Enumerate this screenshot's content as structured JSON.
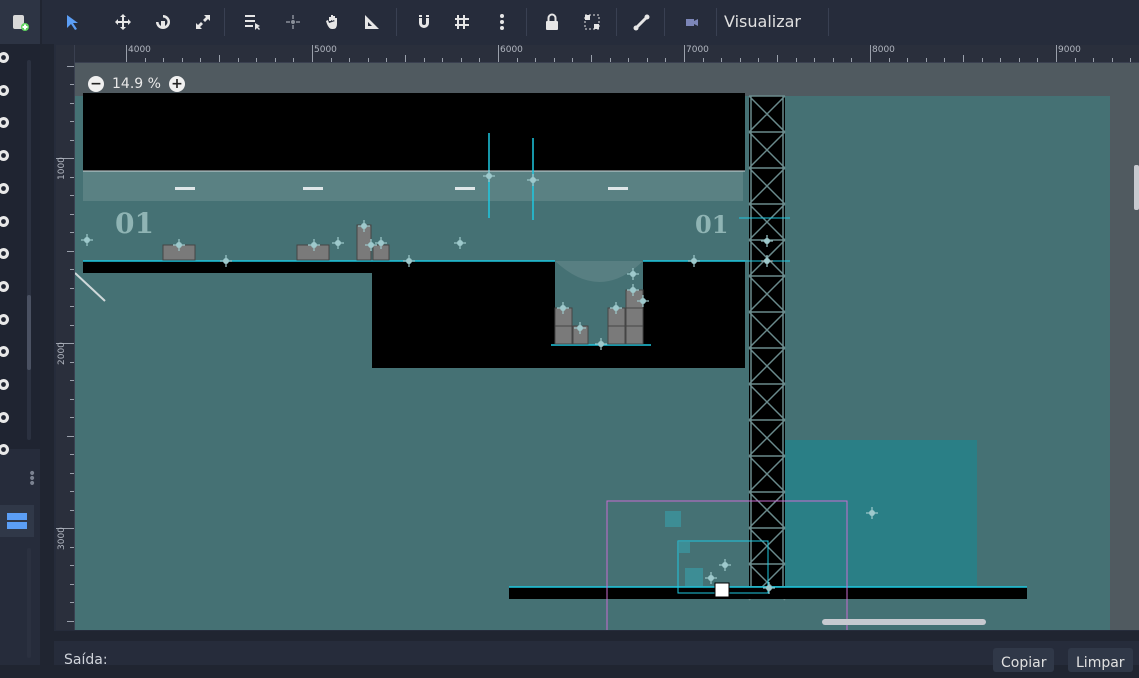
{
  "toolbar": {
    "tools": [
      {
        "name": "select-tool",
        "icon": "arrow-select-icon"
      },
      {
        "name": "move-tool",
        "icon": "move-icon"
      },
      {
        "name": "rotate-tool",
        "icon": "rotate-icon"
      },
      {
        "name": "scale-tool",
        "icon": "scale-icon"
      },
      {
        "name": "list-select-tool",
        "icon": "list-select-icon"
      },
      {
        "name": "pivot-tool",
        "icon": "pivot-icon"
      },
      {
        "name": "pan-tool",
        "icon": "hand-icon"
      },
      {
        "name": "ruler-tool",
        "icon": "ruler-icon"
      },
      {
        "name": "smart-snap-toggle",
        "icon": "magnet-icon"
      },
      {
        "name": "grid-snap-toggle",
        "icon": "grid-snap-icon"
      },
      {
        "name": "snap-options",
        "icon": "kebab-icon"
      },
      {
        "name": "lock-button",
        "icon": "lock-icon"
      },
      {
        "name": "group-button",
        "icon": "group-icon"
      },
      {
        "name": "skeleton-button",
        "icon": "bone-icon"
      },
      {
        "name": "camera-override-button",
        "icon": "camera-icon"
      }
    ],
    "view_menu_label": "Visualizar"
  },
  "viewport": {
    "zoom_label": "14.9 %",
    "ruler_top_labels": [
      "4000",
      "5000",
      "6000",
      "7000",
      "8000",
      "9000"
    ],
    "ruler_left_labels": [
      "1000",
      "2000",
      "3000"
    ],
    "room_label_left": "01",
    "room_label_right": "01",
    "colors": {
      "background": "#457174",
      "solid": "#000000",
      "highlight_area": "#2a7f86",
      "selection_cyan": "#1ec8e0",
      "camera_rect": "#c86cd0"
    }
  },
  "output_panel": {
    "title": "Saída:",
    "copy_button": "Copiar",
    "clear_button": "Limpar"
  }
}
